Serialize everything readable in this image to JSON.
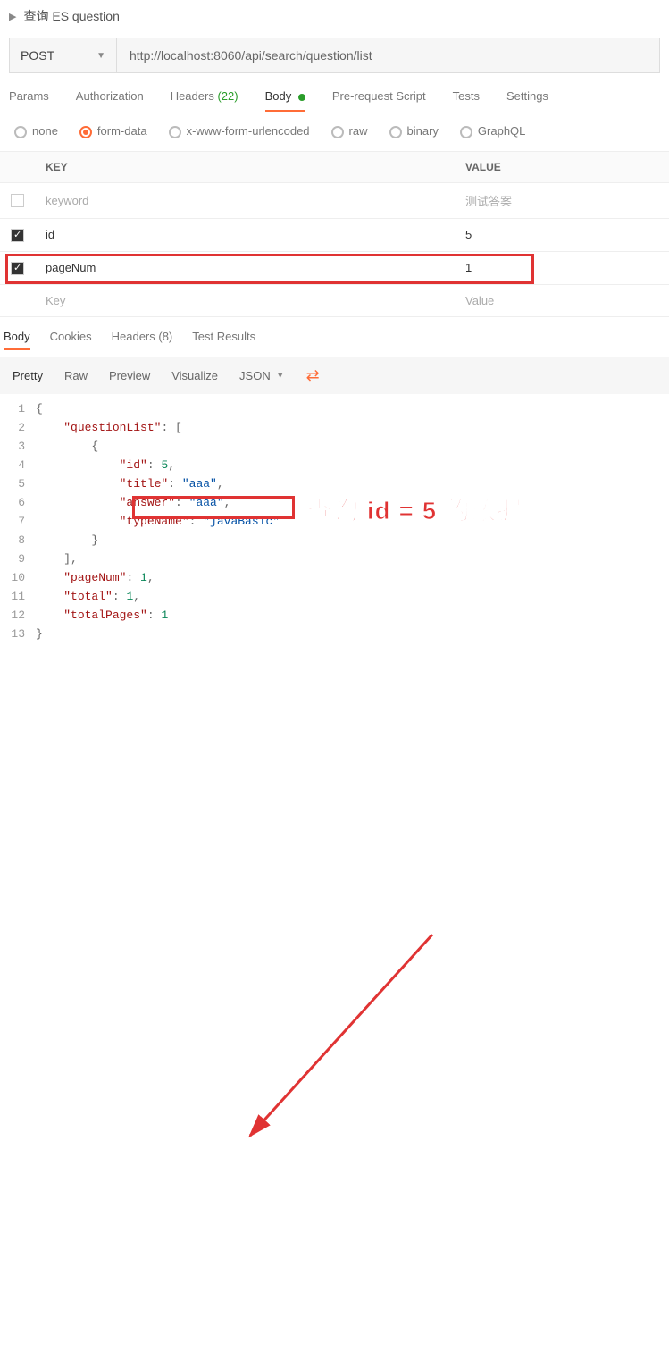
{
  "header": {
    "title": "查询 ES question"
  },
  "request": {
    "method": "POST",
    "url": "http://localhost:8060/api/search/question/list"
  },
  "tabs": {
    "params": "Params",
    "auth": "Authorization",
    "headers_label": "Headers",
    "headers_count": "(22)",
    "body": "Body",
    "prereq": "Pre-request Script",
    "tests": "Tests",
    "settings": "Settings"
  },
  "body_types": {
    "none": "none",
    "formdata": "form-data",
    "xform": "x-www-form-urlencoded",
    "raw": "raw",
    "binary": "binary",
    "graphql": "GraphQL"
  },
  "params_table": {
    "key_header": "KEY",
    "value_header": "VALUE",
    "rows": [
      {
        "checked": false,
        "key": "keyword",
        "value": "测试答案",
        "muted": true
      },
      {
        "checked": true,
        "key": "id",
        "value": "5"
      },
      {
        "checked": true,
        "key": "pageNum",
        "value": "1"
      }
    ],
    "placeholder_key": "Key",
    "placeholder_value": "Value"
  },
  "response_tabs": {
    "body": "Body",
    "cookies": "Cookies",
    "headers_label": "Headers",
    "headers_count": "(8)",
    "test_results": "Test Results"
  },
  "view_bar": {
    "pretty": "Pretty",
    "raw": "Raw",
    "preview": "Preview",
    "visualize": "Visualize",
    "format": "JSON"
  },
  "json_response": {
    "questionList": [
      {
        "id": 5,
        "title": "aaa",
        "answer": "aaa",
        "typeName": "javaBasic"
      }
    ],
    "pageNum": 1,
    "total": 1,
    "totalPages": 1
  },
  "annotation_text": "查询 id = 5 的数据"
}
